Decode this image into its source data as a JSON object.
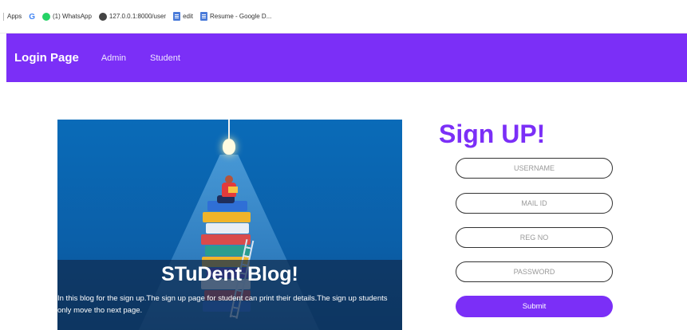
{
  "bookmarks": {
    "apps": "Apps",
    "google": "G",
    "whatsapp": "(1) WhatsApp",
    "localhost": "127.0.0.1:8000/user",
    "edit": "edit",
    "resume": "Resume - Google D..."
  },
  "navbar": {
    "brand": "Login Page",
    "links": [
      "Admin",
      "Student"
    ],
    "color": "#7b2ff7"
  },
  "hero": {
    "title": "STuDent Blog!",
    "text": "In this blog for the sign up.The sign up page for student can print their details.The sign up students only move tho next page."
  },
  "form": {
    "title": "Sign UP!",
    "fields": [
      {
        "placeholder": "USERNAME"
      },
      {
        "placeholder": "MAIL ID"
      },
      {
        "placeholder": "REG NO"
      },
      {
        "placeholder": "PASSWORD"
      }
    ],
    "submit_label": "Submit"
  }
}
